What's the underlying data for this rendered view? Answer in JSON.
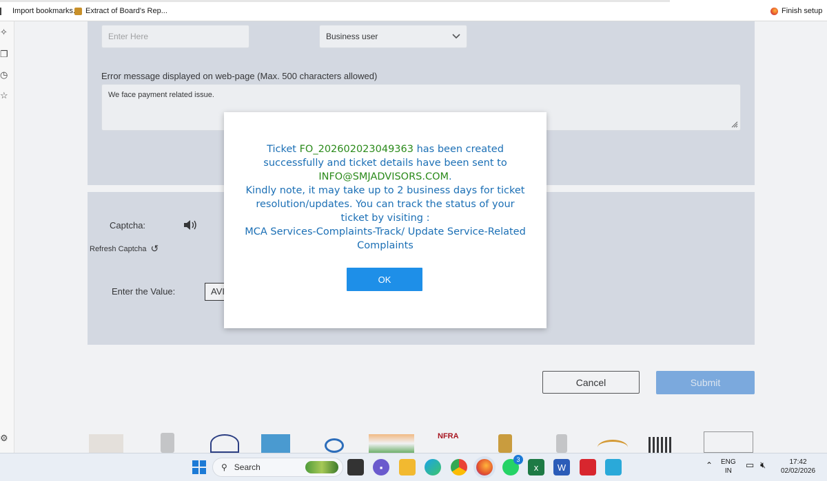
{
  "bookmarks": {
    "items": [
      {
        "label": "Import bookmarks..."
      },
      {
        "label": "Extract of Board's Rep..."
      }
    ],
    "finish_setup": "Finish setup"
  },
  "form": {
    "name_placeholder": "Enter Here",
    "user_type_value": "Business user",
    "error_label": "Error message displayed on web-page (Max. 500 characters allowed)",
    "error_value": "We face payment related issue.",
    "captcha_label": "Captcha:",
    "refresh_captcha": "Refresh Captcha",
    "enter_value_label": "Enter the Value:",
    "value_text": "AVI",
    "cancel": "Cancel",
    "submit": "Submit"
  },
  "footer_logos": [
    "NFRA"
  ],
  "modal": {
    "ticket_prefix": "Ticket ",
    "ticket_id": "FO_202602023049363",
    "ticket_suffix": " has been created successfully and ticket details have been sent to ",
    "email": "INFO@SMJADVISORS.COM",
    "period": ".",
    "note": "Kindly note, it may take up to 2 business days for ticket resolution/updates. You can track the status of your ticket by visiting :",
    "path": "MCA Services-Complaints-Track/ Update Service-Related Complaints",
    "ok": "OK"
  },
  "taskbar": {
    "search": "Search",
    "whatsapp_badge": "3",
    "lang_line1": "ENG",
    "lang_line2": "IN",
    "time": "17:42",
    "date": "02/02/2026"
  },
  "colors": {
    "accent": "#1e8fe8",
    "modal_text": "#1b6fb5",
    "ticket_green": "#2a8a1a",
    "panel": "#dfe3eb"
  }
}
